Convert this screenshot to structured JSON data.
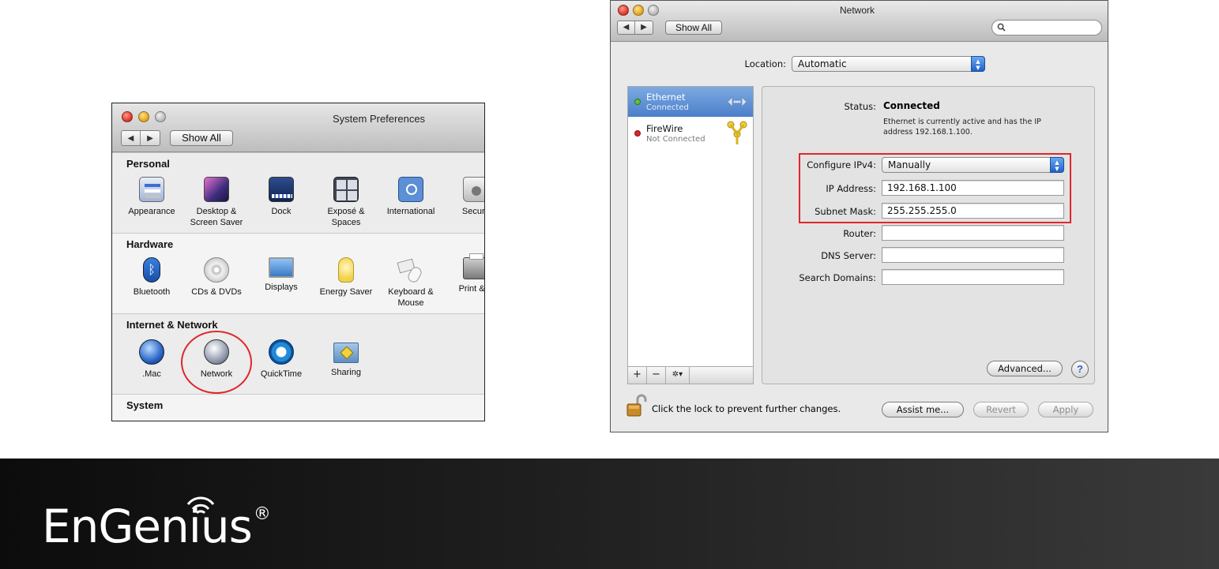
{
  "system_preferences": {
    "title": "System Preferences",
    "show_all": "Show All",
    "sections": [
      {
        "heading": "Personal",
        "items": [
          {
            "label": "Appearance",
            "icon": "appearance-icon"
          },
          {
            "label": "Desktop & Screen Saver",
            "icon": "desktop-icon"
          },
          {
            "label": "Dock",
            "icon": "dock-icon"
          },
          {
            "label": "Exposé & Spaces",
            "icon": "expose-icon"
          },
          {
            "label": "International",
            "icon": "international-icon"
          },
          {
            "label": "Securit",
            "icon": "security-icon"
          }
        ]
      },
      {
        "heading": "Hardware",
        "items": [
          {
            "label": "Bluetooth",
            "icon": "bluetooth-icon"
          },
          {
            "label": "CDs & DVDs",
            "icon": "cd-icon"
          },
          {
            "label": "Displays",
            "icon": "display-icon"
          },
          {
            "label": "Energy Saver",
            "icon": "lightbulb-icon"
          },
          {
            "label": "Keyboard & Mouse",
            "icon": "keyboard-mouse-icon"
          },
          {
            "label": "Print & F",
            "icon": "printer-icon"
          }
        ]
      },
      {
        "heading": "Internet & Network",
        "items": [
          {
            "label": ".Mac",
            "icon": "dotmac-icon"
          },
          {
            "label": "Network",
            "icon": "network-globe-icon"
          },
          {
            "label": "QuickTime",
            "icon": "quicktime-icon"
          },
          {
            "label": "Sharing",
            "icon": "sharing-folder-icon"
          }
        ]
      },
      {
        "heading": "System",
        "items": []
      }
    ]
  },
  "network": {
    "title": "Network",
    "show_all": "Show All",
    "search_placeholder": "",
    "location_label": "Location:",
    "location_value": "Automatic",
    "services": [
      {
        "name": "Ethernet",
        "status": "Connected",
        "dot_color": "#5fc236",
        "selected": true,
        "icon": "ethernet-arrows-icon"
      },
      {
        "name": "FireWire",
        "status": "Not Connected",
        "dot_color": "#d9262c",
        "selected": false,
        "icon": "firewire-icon"
      }
    ],
    "list_buttons": {
      "add": "+",
      "remove": "−",
      "action": "✲▾"
    },
    "status_label": "Status:",
    "status_value": "Connected",
    "status_note": "Ethernet is currently active and has the IP address 192.168.1.100.",
    "configure_label": "Configure IPv4:",
    "configure_value": "Manually",
    "ip_label": "IP Address:",
    "ip_value": "192.168.1.100",
    "mask_label": "Subnet Mask:",
    "mask_value": "255.255.255.0",
    "router_label": "Router:",
    "router_value": "",
    "dns_label": "DNS Server:",
    "dns_value": "",
    "search_domains_label": "Search Domains:",
    "search_domains_value": "",
    "advanced_button": "Advanced...",
    "help_button": "?",
    "lock_text": "Click the lock to prevent further changes.",
    "assist_button": "Assist me...",
    "revert_button": "Revert",
    "apply_button": "Apply"
  },
  "footer": {
    "brand": "EnGenius",
    "registered": "®"
  },
  "colors": {
    "highlight_red": "#e0262a",
    "selection_blue": "#4b7fc9",
    "footer_dark": "#0c0c0c"
  }
}
